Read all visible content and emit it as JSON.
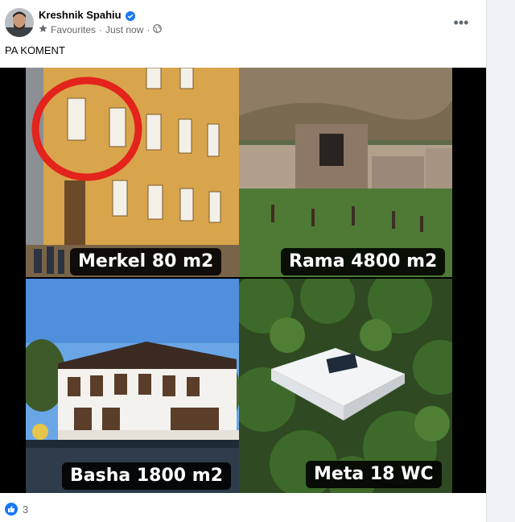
{
  "post": {
    "author": "Kreshnik Spahiu",
    "audience": "Favourites",
    "time": "Just now",
    "caption": "PA KOMENT",
    "more_label": "•••"
  },
  "image": {
    "panels": [
      {
        "label": "Merkel 80 m2"
      },
      {
        "label": "Rama 4800 m2"
      },
      {
        "label": "Basha 1800 m2"
      },
      {
        "label": "Meta 18 WC"
      }
    ]
  },
  "reactions": {
    "count": "3"
  },
  "colors": {
    "accent": "#1877f2",
    "secondary_text": "#65676b"
  },
  "icons": {
    "verified": "verified-badge-icon",
    "favourites": "star-icon",
    "audience": "globe-icon",
    "more": "more-dots-icon",
    "like": "like-icon"
  }
}
